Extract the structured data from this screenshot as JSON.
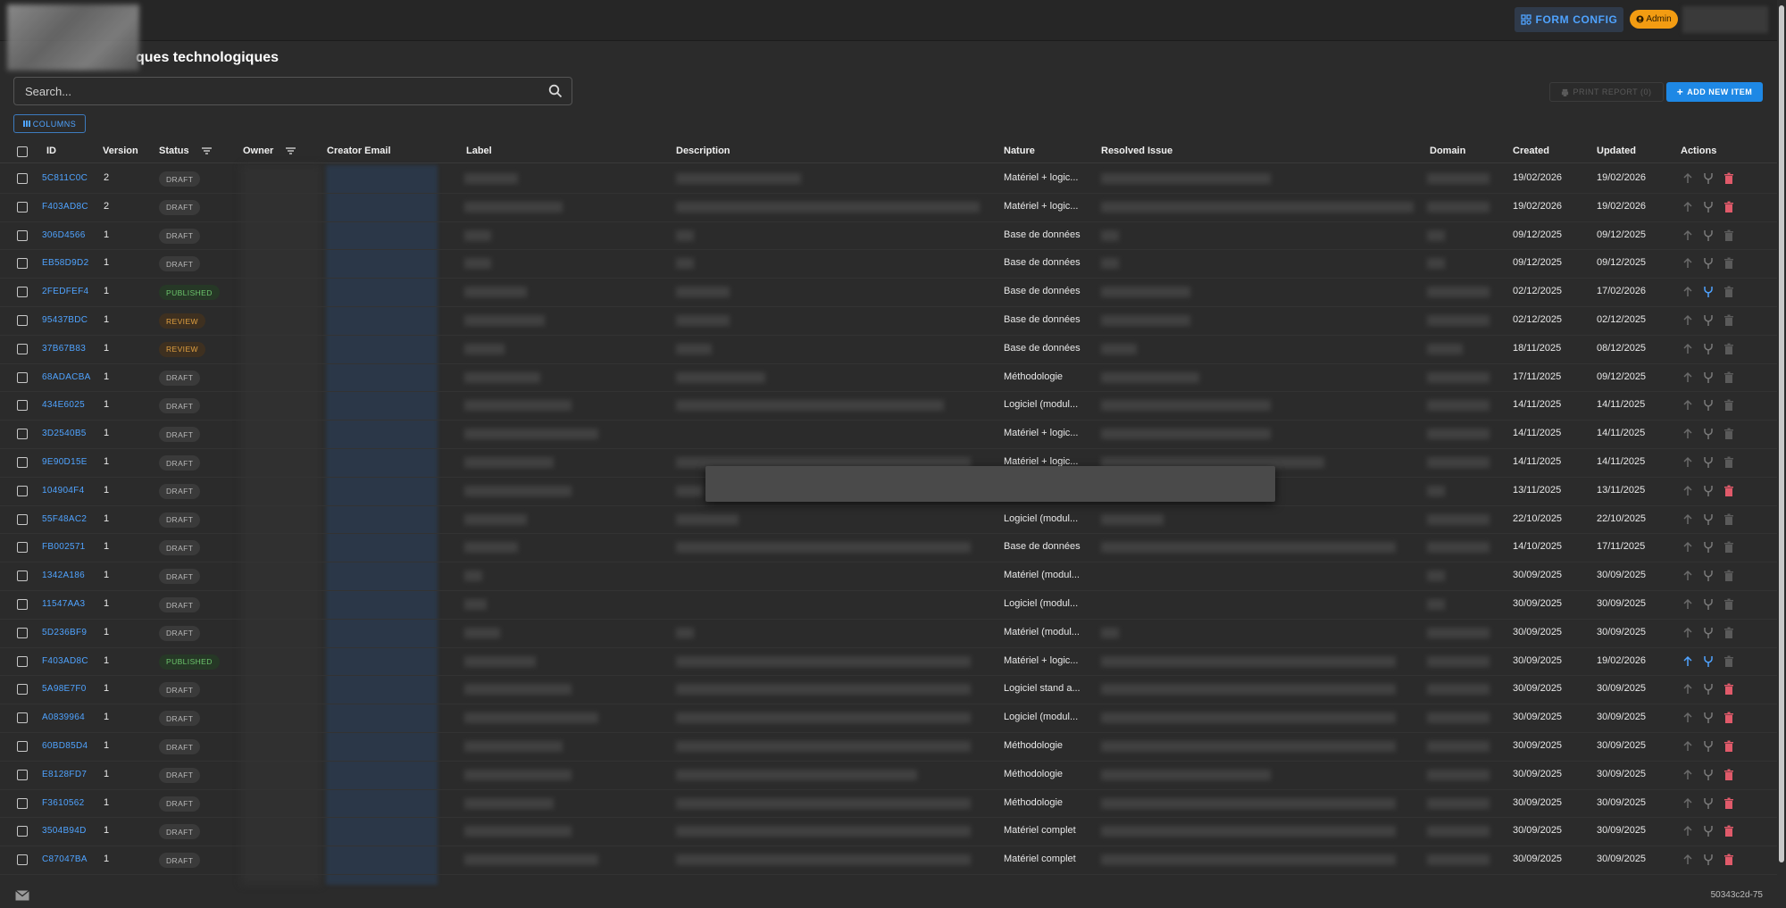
{
  "header": {
    "form_config_label": "FORM CONFIG",
    "admin_badge": "Admin",
    "title": "ques technologiques"
  },
  "toolbar": {
    "search_placeholder": "Search...",
    "print_report_label": "PRINT REPORT (0)",
    "add_new_item_label": "ADD NEW ITEM",
    "columns_label": "COLUMNS"
  },
  "table": {
    "headers": {
      "id": "ID",
      "version": "Version",
      "status": "Status",
      "owner": "Owner",
      "creator_email": "Creator Email",
      "label": "Label",
      "description": "Description",
      "nature": "Nature",
      "resolved_issue": "Resolved Issue",
      "domain": "Domain",
      "created": "Created",
      "updated": "Updated",
      "actions": "Actions"
    },
    "rows": [
      {
        "id": "5C811C0C",
        "version": "2",
        "status": "DRAFT",
        "nature": "Matériel + logic...",
        "created": "19/02/2026",
        "updated": "19/02/2026",
        "delete_active": true,
        "fork_active": false,
        "up_active": false
      },
      {
        "id": "F403AD8C",
        "version": "2",
        "status": "DRAFT",
        "nature": "Matériel + logic...",
        "created": "19/02/2026",
        "updated": "19/02/2026",
        "delete_active": true,
        "fork_active": false,
        "up_active": false
      },
      {
        "id": "306D4566",
        "version": "1",
        "status": "DRAFT",
        "nature": "Base de données",
        "created": "09/12/2025",
        "updated": "09/12/2025",
        "delete_active": false,
        "fork_active": false,
        "up_active": false
      },
      {
        "id": "EB58D9D2",
        "version": "1",
        "status": "DRAFT",
        "nature": "Base de données",
        "created": "09/12/2025",
        "updated": "09/12/2025",
        "delete_active": false,
        "fork_active": false,
        "up_active": false
      },
      {
        "id": "2FEDFEF4",
        "version": "1",
        "status": "PUBLISHED",
        "nature": "Base de données",
        "created": "02/12/2025",
        "updated": "17/02/2026",
        "delete_active": false,
        "fork_active": true,
        "up_active": false
      },
      {
        "id": "95437BDC",
        "version": "1",
        "status": "REVIEW",
        "nature": "Base de données",
        "created": "02/12/2025",
        "updated": "02/12/2025",
        "delete_active": false,
        "fork_active": false,
        "up_active": false
      },
      {
        "id": "37B67B83",
        "version": "1",
        "status": "REVIEW",
        "nature": "Base de données",
        "created": "18/11/2025",
        "updated": "08/12/2025",
        "delete_active": false,
        "fork_active": false,
        "up_active": false
      },
      {
        "id": "68ADACBA",
        "version": "1",
        "status": "DRAFT",
        "nature": "Méthodologie",
        "created": "17/11/2025",
        "updated": "09/12/2025",
        "delete_active": false,
        "fork_active": false,
        "up_active": false
      },
      {
        "id": "434E6025",
        "version": "1",
        "status": "DRAFT",
        "nature": "Logiciel (modul...",
        "created": "14/11/2025",
        "updated": "14/11/2025",
        "delete_active": false,
        "fork_active": false,
        "up_active": false
      },
      {
        "id": "3D2540B5",
        "version": "1",
        "status": "DRAFT",
        "nature": "Matériel + logic...",
        "created": "14/11/2025",
        "updated": "14/11/2025",
        "delete_active": false,
        "fork_active": false,
        "up_active": false
      },
      {
        "id": "9E90D15E",
        "version": "1",
        "status": "DRAFT",
        "nature": "Matériel + logic...",
        "created": "14/11/2025",
        "updated": "14/11/2025",
        "delete_active": false,
        "fork_active": false,
        "up_active": false
      },
      {
        "id": "104904F4",
        "version": "1",
        "status": "DRAFT",
        "nature": "",
        "created": "13/11/2025",
        "updated": "13/11/2025",
        "delete_active": true,
        "fork_active": false,
        "up_active": false
      },
      {
        "id": "55F48AC2",
        "version": "1",
        "status": "DRAFT",
        "nature": "Logiciel (modul...",
        "created": "22/10/2025",
        "updated": "22/10/2025",
        "delete_active": false,
        "fork_active": false,
        "up_active": false
      },
      {
        "id": "FB002571",
        "version": "1",
        "status": "DRAFT",
        "nature": "Base de données",
        "created": "14/10/2025",
        "updated": "17/11/2025",
        "delete_active": false,
        "fork_active": false,
        "up_active": false
      },
      {
        "id": "1342A186",
        "version": "1",
        "status": "DRAFT",
        "nature": "Matériel (modul...",
        "created": "30/09/2025",
        "updated": "30/09/2025",
        "delete_active": false,
        "fork_active": false,
        "up_active": false
      },
      {
        "id": "11547AA3",
        "version": "1",
        "status": "DRAFT",
        "nature": "Logiciel (modul...",
        "created": "30/09/2025",
        "updated": "30/09/2025",
        "delete_active": false,
        "fork_active": false,
        "up_active": false
      },
      {
        "id": "5D236BF9",
        "version": "1",
        "status": "DRAFT",
        "nature": "Matériel (modul...",
        "created": "30/09/2025",
        "updated": "30/09/2025",
        "delete_active": false,
        "fork_active": false,
        "up_active": false
      },
      {
        "id": "F403AD8C",
        "version": "1",
        "status": "PUBLISHED",
        "nature": "Matériel + logic...",
        "created": "30/09/2025",
        "updated": "19/02/2026",
        "delete_active": false,
        "fork_active": true,
        "up_active": true
      },
      {
        "id": "5A98E7F0",
        "version": "1",
        "status": "DRAFT",
        "nature": "Logiciel stand a...",
        "created": "30/09/2025",
        "updated": "30/09/2025",
        "delete_active": true,
        "fork_active": false,
        "up_active": false
      },
      {
        "id": "A0839964",
        "version": "1",
        "status": "DRAFT",
        "nature": "Logiciel (modul...",
        "created": "30/09/2025",
        "updated": "30/09/2025",
        "delete_active": true,
        "fork_active": false,
        "up_active": false
      },
      {
        "id": "60BD85D4",
        "version": "1",
        "status": "DRAFT",
        "nature": "Méthodologie",
        "created": "30/09/2025",
        "updated": "30/09/2025",
        "delete_active": true,
        "fork_active": false,
        "up_active": false
      },
      {
        "id": "E8128FD7",
        "version": "1",
        "status": "DRAFT",
        "nature": "Méthodologie",
        "created": "30/09/2025",
        "updated": "30/09/2025",
        "delete_active": true,
        "fork_active": false,
        "up_active": false
      },
      {
        "id": "F3610562",
        "version": "1",
        "status": "DRAFT",
        "nature": "Méthodologie",
        "created": "30/09/2025",
        "updated": "30/09/2025",
        "delete_active": true,
        "fork_active": false,
        "up_active": false
      },
      {
        "id": "3504B94D",
        "version": "1",
        "status": "DRAFT",
        "nature": "Matériel complet",
        "created": "30/09/2025",
        "updated": "30/09/2025",
        "delete_active": true,
        "fork_active": false,
        "up_active": false
      },
      {
        "id": "C87047BA",
        "version": "1",
        "status": "DRAFT",
        "nature": "Matériel complet",
        "created": "30/09/2025",
        "updated": "30/09/2025",
        "delete_active": true,
        "fork_active": false,
        "up_active": false
      }
    ]
  },
  "footer": {
    "version_tag": "50343c2d-75"
  },
  "colors": {
    "accent": "#1e88e5",
    "link": "#4fa3ff",
    "delete": "#e05a6a",
    "admin": "#f39c12"
  },
  "icons": {
    "search": "search-icon",
    "filter": "filter-icon",
    "columns": "columns-icon",
    "print": "print-icon",
    "add": "plus-icon",
    "upgrade": "arrow-up-icon",
    "fork": "fork-icon",
    "delete": "trash-icon",
    "mail": "mail-icon"
  }
}
